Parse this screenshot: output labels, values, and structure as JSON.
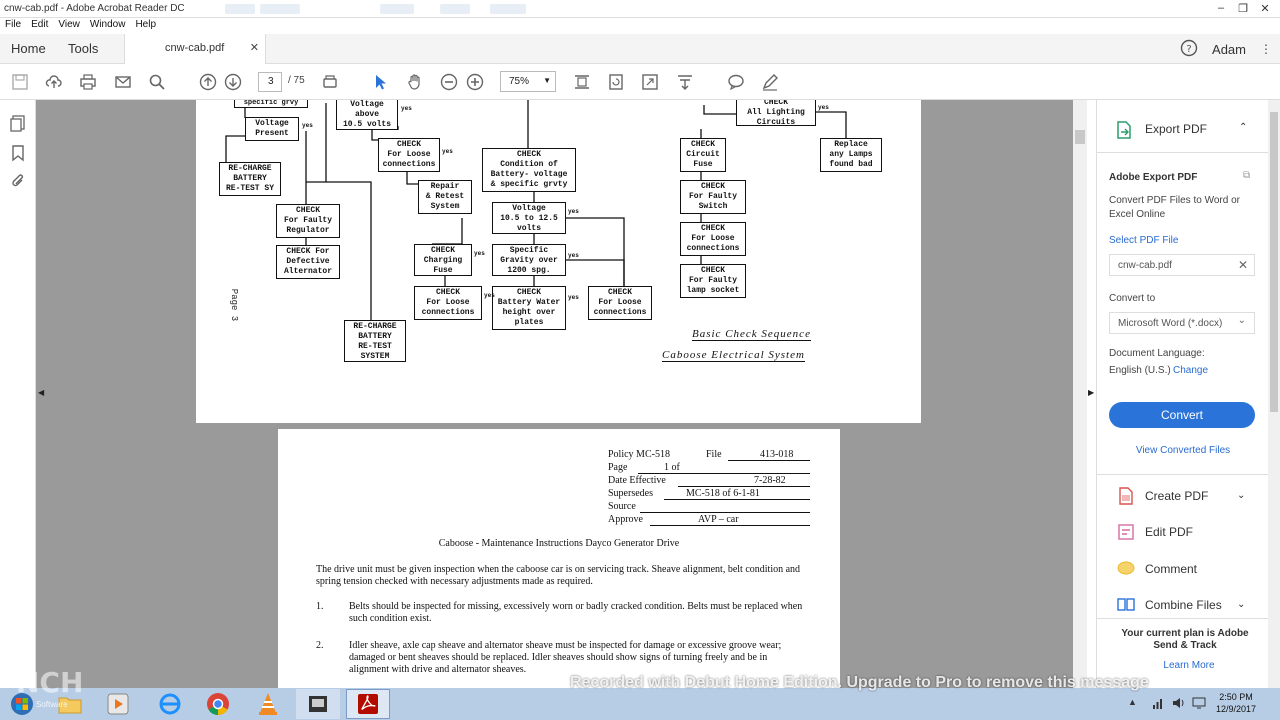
{
  "window": {
    "title": "cnw-cab.pdf - Adobe Acrobat Reader DC",
    "minimize_icon": "minimize-icon",
    "restore_icon": "restore-icon",
    "close_icon": "close-icon"
  },
  "menu": [
    "File",
    "Edit",
    "View",
    "Window",
    "Help"
  ],
  "tabs": {
    "home": "Home",
    "tools": "Tools",
    "document": "cnw-cab.pdf",
    "user": "Adam"
  },
  "toolbar": {
    "page_current": "3",
    "page_total": "/ 75",
    "zoom": "75%"
  },
  "flowchart": {
    "page_label": "Page 3",
    "boxes": {
      "b1": "specific grvy",
      "b2": "Voltage\nPresent",
      "b3": "RE-CHARGE\nBATTERY\nRE-TEST SY",
      "b4": "CHECK\nFor Faulty\nRegulator",
      "b5": "CHECK For\nDefective\nAlternator",
      "b6": "Voltage\nabove\n10.5 volts",
      "b7": "CHECK\nFor Loose\nconnections",
      "b8": "Repair\n& Retest\nSystem",
      "b9": "CHECK\nCondition of\nBattery- voltage\n& specific grvty",
      "b10": "Voltage\n10.5 to 12.5\nvolts",
      "b11": "CHECK\nCharging\nFuse",
      "b12": "Specific\nGravity over\n1200 spg.",
      "b13": "CHECK\nFor Loose\nconnections",
      "b14": "CHECK\nBattery Water\nheight over\nplates",
      "b15": "CHECK\nFor Loose\nconnections",
      "b16": "RE-CHARGE\nBATTERY\nRE-TEST\nSYSTEM",
      "b17": "CHECK\nAll Lighting\nCircuits",
      "b18": "Replace\nany Lamps\nfound bad",
      "b19": "CHECK\nCircuit\nFuse",
      "b20": "CHECK\nFor Faulty\nSwitch",
      "b21": "CHECK\nFor Loose\nconnections",
      "b22": "CHECK\nFor Faulty\nlamp socket"
    },
    "yes": "yes",
    "heading1": "Basic Check Sequence",
    "heading2": "Caboose Electrical System"
  },
  "policy": {
    "policy_label": "Policy MC-518",
    "file_label": "File",
    "file_value": "413-018",
    "page_label": "Page",
    "page_value": "1 of",
    "date_label": "Date Effective",
    "date_value": "7-28-82",
    "supersedes_label": "Supersedes",
    "supersedes_value": "MC-518   of   6-1-81",
    "source_label": "Source",
    "approve_label": "Approve",
    "approve_value": "AVP – car",
    "title": "Caboose - Maintenance Instructions Dayco Generator Drive",
    "intro": "The drive unit must be given inspection when the caboose car is on servicing track. Sheave alignment, belt condition and spring tension checked with necessary adjustments made as required.",
    "items": [
      {
        "num": "1.",
        "text": "Belts should be inspected for missing, excessively worn or badly cracked condition. Belts must be replaced when such condition exist."
      },
      {
        "num": "2.",
        "text": "Idler sheave, axle cap sheave and alternator sheave must be inspected for damage or excessive groove wear; damaged or bent sheaves should be replaced. Idler sheaves should show signs of turning freely and be in alignment with drive and alternator sheaves."
      }
    ]
  },
  "right_panel": {
    "export_title": "Export PDF",
    "adobe_export_title": "Adobe Export PDF",
    "description": "Convert PDF Files to Word or Excel Online",
    "select_label": "Select PDF File",
    "selected_file": "cnw-cab.pdf",
    "convert_to_label": "Convert to",
    "convert_to_value": "Microsoft Word (*.docx)",
    "language_label": "Document Language:",
    "language_value": "English (U.S.)",
    "change_link": "Change",
    "convert_button": "Convert",
    "view_converted": "View Converted Files",
    "tools": [
      "Create PDF",
      "Edit PDF",
      "Comment",
      "Combine Files"
    ],
    "plan_text": "Your current plan is Adobe Send & Track",
    "learn_more": "Learn More"
  },
  "taskbar": {
    "time": "2:50 PM",
    "date": "12/9/2017"
  },
  "overlay": {
    "watermark": "Recorded with Debut Home Edition. Upgrade to Pro to remove this message",
    "logo": "NCH",
    "logo_sub": "Software"
  },
  "colors": {
    "accent": "#2a73d9",
    "doc_background": "#9a9a9a",
    "taskbar": "#b7cde6"
  }
}
